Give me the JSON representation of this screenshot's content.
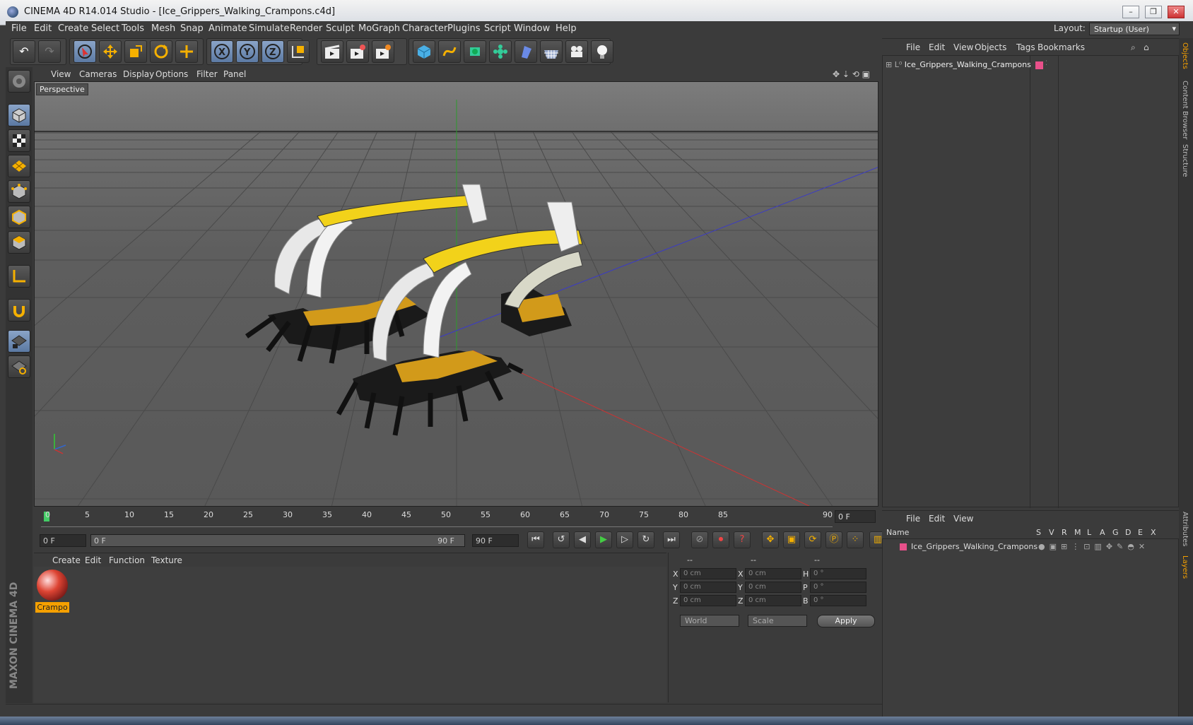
{
  "window": {
    "title": "CINEMA 4D R14.014 Studio - [Ice_Grippers_Walking_Crampons.c4d]",
    "minimize": "–",
    "maximize": "❐",
    "close": "✕"
  },
  "menu": [
    "File",
    "Edit",
    "Create",
    "Select",
    "Tools",
    "Mesh",
    "Snap",
    "Animate",
    "Simulate",
    "Render",
    "Sculpt",
    "MoGraph",
    "Character",
    "Plugins",
    "Script",
    "Window",
    "Help"
  ],
  "layout": {
    "label": "Layout:",
    "value": "Startup (User)"
  },
  "viewport": {
    "menu": [
      "View",
      "Cameras",
      "Display",
      "Options",
      "Filter",
      "Panel"
    ],
    "label": "Perspective"
  },
  "timeline": {
    "ticks": [
      "0",
      "5",
      "10",
      "15",
      "20",
      "25",
      "30",
      "35",
      "40",
      "45",
      "50",
      "55",
      "60",
      "65",
      "70",
      "75",
      "80",
      "85",
      "90"
    ],
    "end_frame": "0 F",
    "current_frame": "0 F",
    "range_start": "0 F",
    "range_end": "90 F",
    "max_frame": "90 F"
  },
  "material": {
    "menu": [
      "Create",
      "Edit",
      "Function",
      "Texture"
    ],
    "name": "Crampo"
  },
  "coords": {
    "headers": [
      "--",
      "--",
      "--"
    ],
    "pos_labels": [
      "X",
      "Y",
      "Z"
    ],
    "size_labels": [
      "X",
      "Y",
      "Z"
    ],
    "rot_labels": [
      "H",
      "P",
      "B"
    ],
    "pos_values": [
      "0 cm",
      "0 cm",
      "0 cm"
    ],
    "size_values": [
      "0 cm",
      "0 cm",
      "0 cm"
    ],
    "rot_values": [
      "0 °",
      "0 °",
      "0 °"
    ],
    "mode1": "World",
    "mode2": "Scale",
    "apply": "Apply"
  },
  "objects": {
    "menu": [
      "File",
      "Edit",
      "View",
      "Objects",
      "Tags",
      "Bookmarks"
    ],
    "item": "Ice_Grippers_Walking_Crampons",
    "item_color": "#e8508a"
  },
  "layers": {
    "menu": [
      "File",
      "Edit",
      "View"
    ],
    "columns": [
      "Name",
      "S",
      "V",
      "R",
      "M",
      "L",
      "A",
      "G",
      "D",
      "E",
      "X"
    ],
    "item": "Ice_Grippers_Walking_Crampons"
  },
  "side_tabs": [
    "Objects",
    "Content Browser",
    "Structure",
    "Attributes",
    "Layers"
  ],
  "brand": "MAXON CINEMA 4D"
}
